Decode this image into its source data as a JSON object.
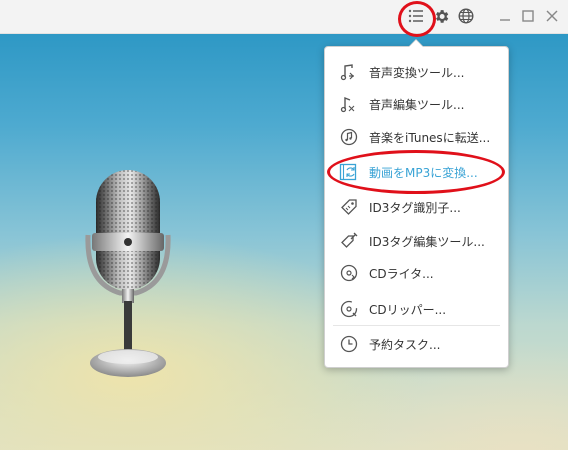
{
  "titlebar": {
    "icons": [
      "menu-list-icon",
      "gear-icon",
      "globe-icon",
      "minimize-icon",
      "maximize-icon",
      "close-icon"
    ]
  },
  "menu": {
    "items": [
      {
        "label": "音声変換ツール...",
        "icon": "music-note-convert-icon"
      },
      {
        "label": "音声編集ツール...",
        "icon": "music-note-edit-icon"
      },
      {
        "label": "音楽をiTunesに転送...",
        "icon": "music-circle-icon"
      },
      {
        "label": "動画をMP3に変換...",
        "icon": "video-convert-icon",
        "active": true
      },
      {
        "label": "ID3タグ識別子...",
        "icon": "tag-icon"
      },
      {
        "label": "ID3タグ編集ツール...",
        "icon": "tag-edit-icon"
      },
      {
        "label": "CDライタ...",
        "icon": "cd-burn-icon"
      },
      {
        "label": "CDリッパー...",
        "icon": "cd-rip-icon"
      },
      {
        "label": "予約タスク...",
        "icon": "clock-icon"
      }
    ]
  },
  "colors": {
    "accent": "#3aa3d5",
    "highlight_ring": "#e0101a",
    "titlebar": "#f3f3f3"
  }
}
